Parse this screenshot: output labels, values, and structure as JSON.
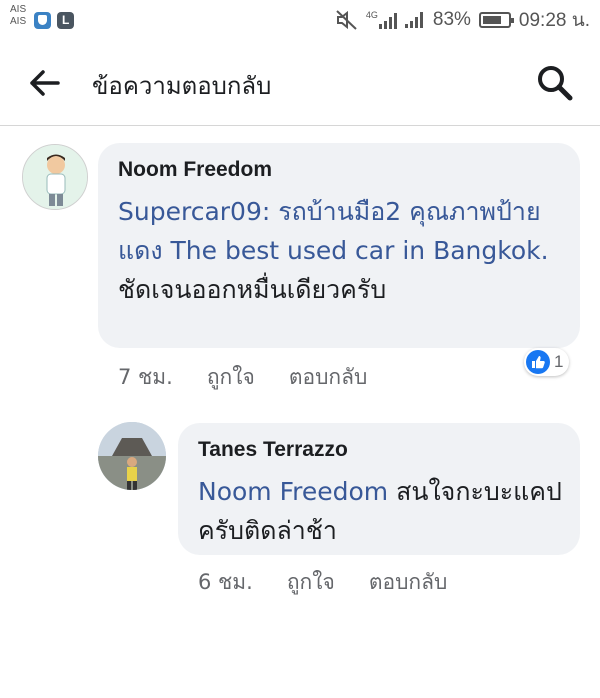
{
  "status_bar": {
    "carrier_1": "AIS",
    "carrier_2": "AIS",
    "network_type": "4G",
    "battery_percent": "83%",
    "time": "09:28 น."
  },
  "header": {
    "title": "ข้อความตอบกลับ"
  },
  "comments": [
    {
      "author": "Noom Freedom",
      "mention": "Supercar09: รถบ้านมือ2 คุณภาพป้ายแดง The best used car in Bangkok.",
      "text": " ชัดเจนออกหมื่นเดียวครับ",
      "time": "7 ชม.",
      "like_label": "ถูกใจ",
      "reply_label": "ตอบกลับ",
      "reaction_count": "1"
    },
    {
      "author": "Tanes Terrazzo",
      "mention": "Noom Freedom",
      "text": " สนใจกะบะแคปครับติดล่าช้า",
      "time": "6 ชม.",
      "like_label": "ถูกใจ",
      "reply_label": "ตอบกลับ"
    }
  ],
  "colors": {
    "link": "#385898",
    "bubble": "#f0f2f5",
    "like_blue": "#1877f2",
    "meta_text": "#65676b"
  },
  "icons": [
    "arrow-back-icon",
    "search-icon",
    "like-reaction-icon",
    "mute-icon",
    "signal-icon",
    "battery-icon",
    "shield-icon",
    "line-app-icon"
  ]
}
